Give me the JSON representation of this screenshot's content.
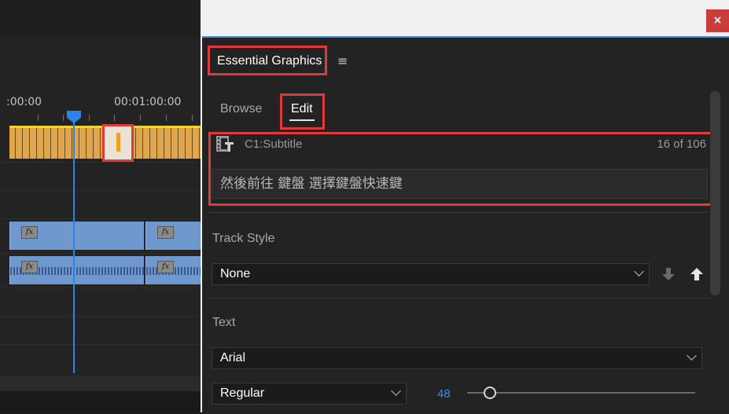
{
  "timeline": {
    "timecode_left": ":00:00",
    "timecode_right": "00:01:00:00",
    "fx_label": "fx"
  },
  "window": {
    "close_label": "×"
  },
  "panel": {
    "title": "Essential Graphics",
    "menu_icon": "≡",
    "tabs": [
      {
        "label": "Browse",
        "active": false
      },
      {
        "label": "Edit",
        "active": true
      }
    ],
    "caption": {
      "icon": "caption-film-icon",
      "name": "C1:Subtitle",
      "count": "16 of 106",
      "text": "然後前往 鍵盤 選擇鍵盤快速鍵"
    },
    "track_style": {
      "label": "Track Style",
      "value": "None"
    },
    "text_section": {
      "label": "Text",
      "font_family": "Arial",
      "font_style": "Regular",
      "font_size": "48",
      "font_size_slider_fraction": 0.1
    }
  },
  "colors": {
    "highlight_red": "#e03a3a",
    "accent_blue": "#3e8ee8",
    "caption_track": "#e0a64e",
    "clip_blue": "#6f98cf"
  }
}
